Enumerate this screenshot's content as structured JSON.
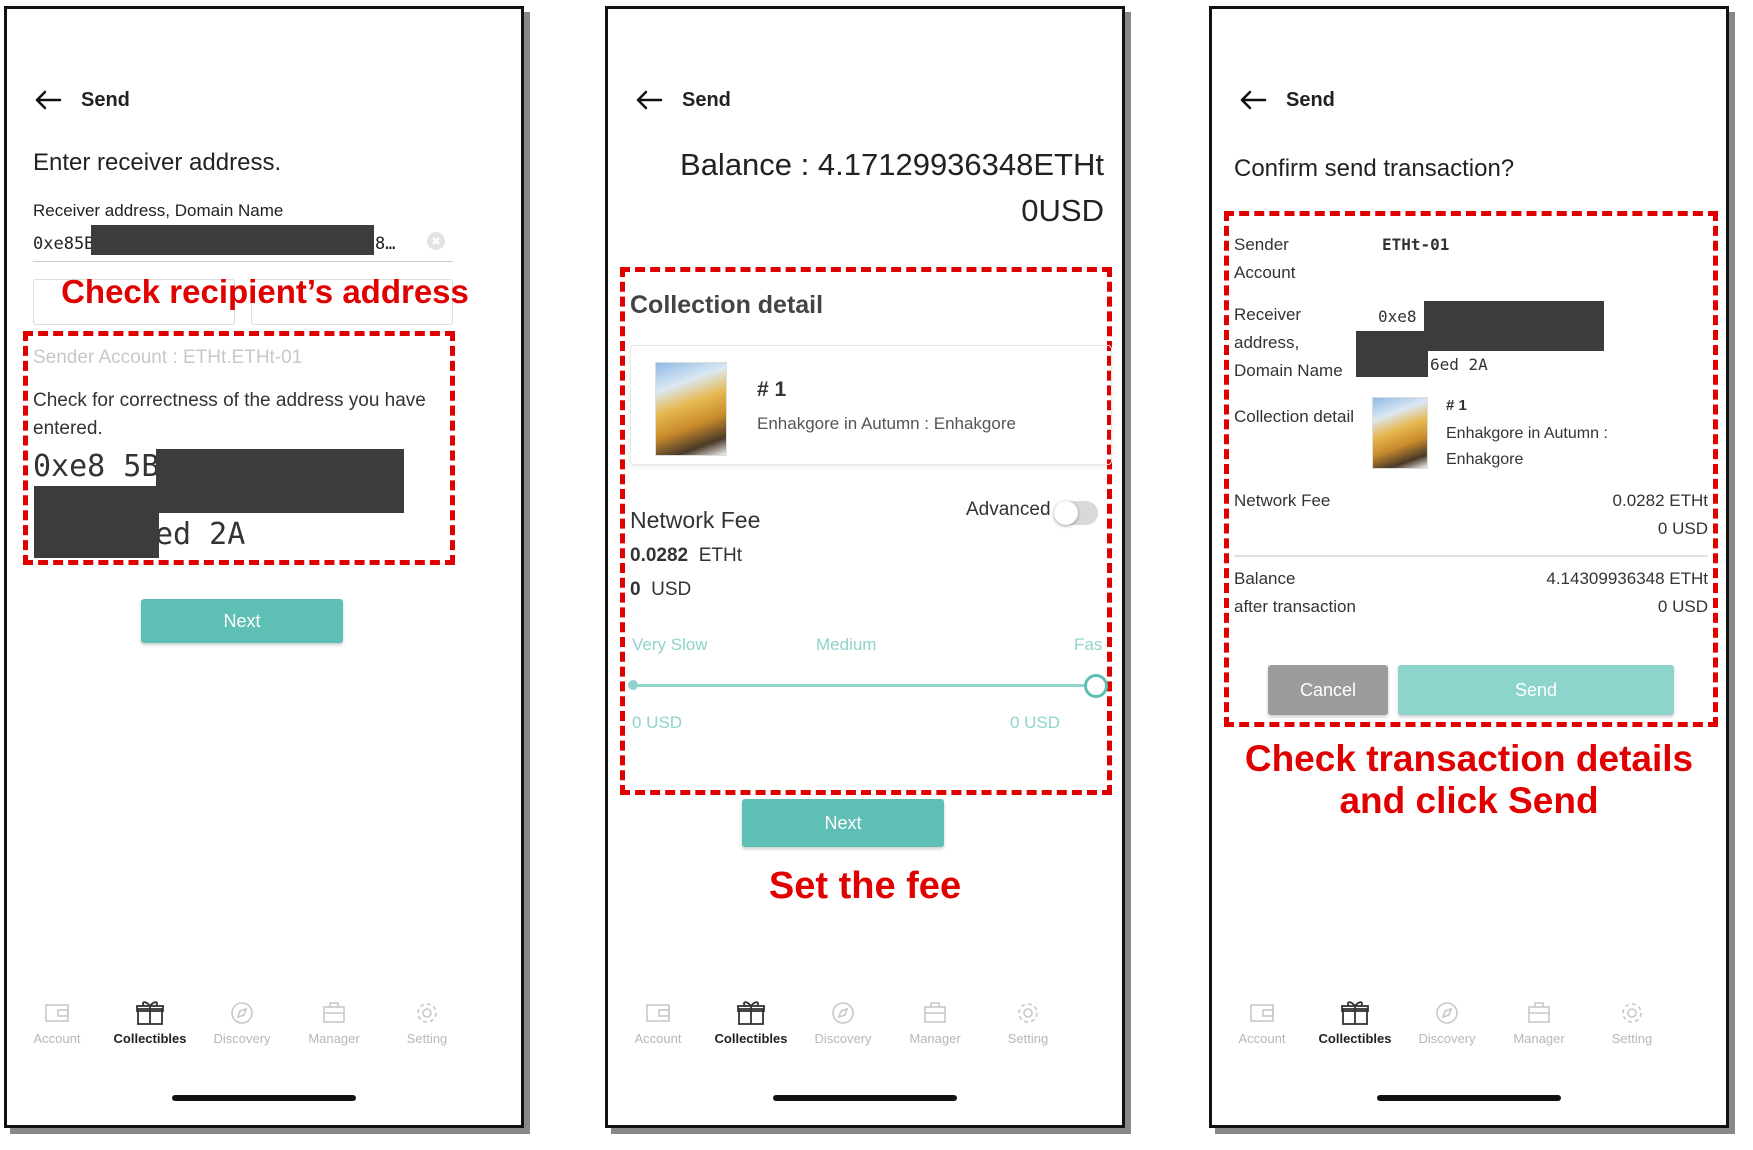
{
  "header": {
    "title": "Send"
  },
  "tabbar": {
    "items": [
      {
        "label": "Account",
        "icon": "wallet-icon",
        "active": false
      },
      {
        "label": "Collectibles",
        "icon": "gift-box-icon",
        "active": true
      },
      {
        "label": "Discovery",
        "icon": "compass-icon",
        "active": false
      },
      {
        "label": "Manager",
        "icon": "briefcase-icon",
        "active": false
      },
      {
        "label": "Setting",
        "icon": "gear-icon",
        "active": false
      }
    ]
  },
  "screen1": {
    "heading": "Enter receiver address.",
    "field_label": "Receiver address, Domain Name",
    "address_start": "0xe85B",
    "address_end": "8…",
    "sender_account": "Sender Account : ETHt.ETHt-01",
    "check_text": "Check for correctness of the address you have entered.",
    "address_big_1": "0xe8  5B",
    "address_big_2": "ed  2A",
    "next_label": "Next",
    "annotation": "Check recipient’s address"
  },
  "screen2": {
    "balance_line1": "Balance : 4.17129936348ETHt",
    "balance_line2": "0USD",
    "collection_title": "Collection detail",
    "item_number": "# 1",
    "item_name": "Enhakgore in Autumn : Enhakgore",
    "network_fee_label": "Network Fee",
    "advanced_label": "Advanced",
    "fee_value": "0.0282",
    "fee_unit": "ETHt",
    "fee_usd_value": "0",
    "fee_usd_unit": "USD",
    "speed_labels": [
      "Very Slow",
      "Medium",
      "Fas"
    ],
    "usd_left": "0 USD",
    "usd_right": "0 USD",
    "slider_level": 1.0,
    "next_label": "Next",
    "annotation": "Set the fee"
  },
  "screen3": {
    "heading": "Confirm send transaction?",
    "sender_label_1": "Sender",
    "sender_label_2": "Account",
    "sender_value": "ETHt-01",
    "receiver_label_1": "Receiver",
    "receiver_label_2": "address,",
    "receiver_label_3": "Domain Name",
    "receiver_start": "0xe8  5",
    "receiver_end": "6ed  2A",
    "collection_label": "Collection detail",
    "item_number": "# 1",
    "item_name_1": "Enhakgore in Autumn :",
    "item_name_2": "Enhakgore",
    "network_fee_label": "Network Fee",
    "fee_value": "0.0282 ETHt",
    "fee_usd": "0 USD",
    "balance_label_1": "Balance",
    "balance_label_2": "after transaction",
    "balance_value": "4.14309936348 ETHt",
    "balance_usd": "0 USD",
    "cancel_label": "Cancel",
    "send_label": "Send",
    "annotation_1": "Check transaction details",
    "annotation_2": "and click Send"
  }
}
